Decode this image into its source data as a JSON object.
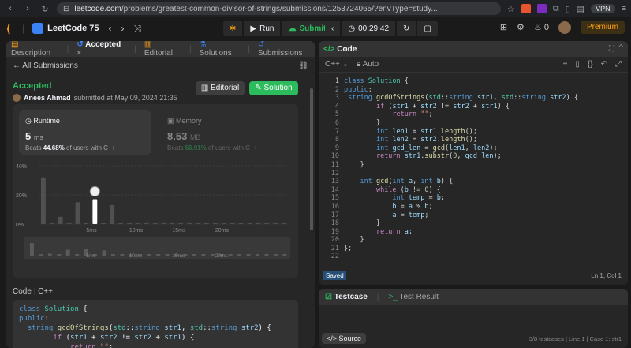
{
  "browser": {
    "url_domain": "leetcode.com",
    "url_path": "/problems/greatest-common-divisor-of-strings/submissions/1253724065/?envType=study...",
    "vpn": "VPN"
  },
  "header": {
    "study_plan": "LeetCode 75",
    "run": "Run",
    "submit": "Submit",
    "timer": "00:29:42",
    "fire_count": "0",
    "premium": "Premium"
  },
  "left": {
    "tabs": [
      "Description",
      "Accepted",
      "Editorial",
      "Solutions",
      "Submissions"
    ],
    "all_submissions": "All Submissions",
    "status": "Accepted",
    "user": "Anees Ahmad",
    "submitted_at": "submitted at May 09, 2024 21:35",
    "editorial_btn": "Editorial",
    "solution_btn": "Solution",
    "runtime": {
      "title": "Runtime",
      "value": "5",
      "unit": "ms",
      "beats_pre": "Beats ",
      "beats": "44.68%",
      "beats_post": " of users with C++"
    },
    "memory": {
      "title": "Memory",
      "value": "8.53",
      "unit": "MB",
      "beats_pre": "Beats ",
      "beats": "56.91%",
      "beats_post": " of users with C++"
    },
    "code_label": "Code",
    "lang": "C++",
    "code_lines": [
      "class Solution {",
      "public:",
      "  string gcdOfStrings(std::string str1, std::string str2) {",
      "        if (str1 + str2 != str2 + str1) {",
      "            return \"\";"
    ]
  },
  "chart_data": {
    "type": "bar",
    "ylim": [
      0,
      40
    ],
    "yticks": [
      "40%",
      "20%",
      "0%"
    ],
    "xticks": [
      "5ms",
      "10ms",
      "15ms",
      "20ms"
    ],
    "values": [
      32,
      1,
      5,
      1,
      15,
      1,
      17,
      1,
      13,
      1,
      1,
      1,
      1,
      1,
      1,
      1,
      1,
      1,
      1,
      1,
      1,
      1,
      1,
      1,
      1,
      1,
      1,
      1,
      1
    ],
    "highlight_index": 6,
    "mini_xticks": [
      "5ms",
      "10ms",
      "15ms",
      "20ms"
    ]
  },
  "right": {
    "title": "Code",
    "lang": "C++",
    "mode": "Auto",
    "line_numbers": [
      "1",
      "2",
      "3",
      "4",
      "5",
      "6",
      "7",
      "8",
      "9",
      "10",
      "11",
      "12",
      "13",
      "14",
      "15",
      "16",
      "17",
      "18",
      "19",
      "20",
      "21",
      "22"
    ],
    "code_lines": [
      "class Solution {",
      "public:",
      " string gcdOfStrings(std::string str1, std::string str2) {",
      "        if (str1 + str2 != str2 + str1) {",
      "            return \"\";",
      "        }",
      "        int len1 = str1.length();",
      "        int len2 = str2.length();",
      "        int gcd_len = gcd(len1, len2);",
      "        return str1.substr(0, gcd_len);",
      "    }",
      "",
      "    int gcd(int a, int b) {",
      "        while (b != 0) {",
      "            int temp = b;",
      "            b = a % b;",
      "            a = temp;",
      "        }",
      "        return a;",
      "    }",
      "};",
      ""
    ],
    "saved": "Saved",
    "cursor": "Ln 1, Col 1"
  },
  "bottom": {
    "testcase_tab": "Testcase",
    "result_tab": "Test Result",
    "source_btn": "Source",
    "tc_info": "3/8 testcases   |   Line 1   |   Case 1: str1"
  }
}
